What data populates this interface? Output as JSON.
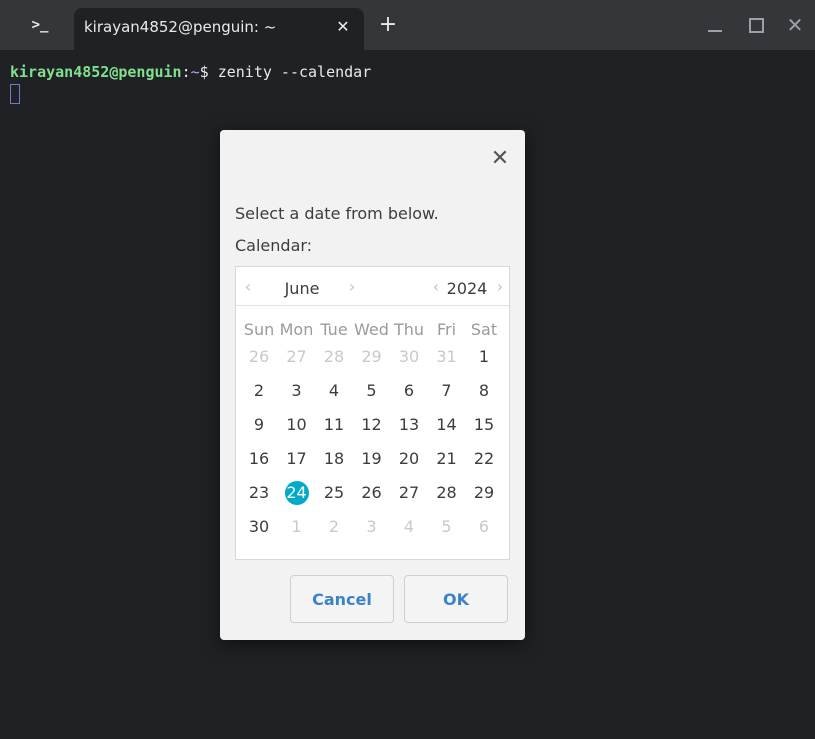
{
  "window": {
    "app_icon": ">_",
    "tab_title": "kirayan4852@penguin: ~",
    "tab_close": "✕",
    "new_tab": "+",
    "close_glyph": "✕"
  },
  "terminal": {
    "prompt_user": "kirayan4852@penguin",
    "prompt_sep": ":",
    "prompt_path": "~",
    "prompt_symbol": "$ ",
    "command": "zenity --calendar"
  },
  "dialog": {
    "close_glyph": "✕",
    "text": "Select a date from below.",
    "label": "Calendar:",
    "calendar": {
      "prev": "‹",
      "next": "›",
      "month": "June",
      "year": "2024",
      "weekdays": [
        "Sun",
        "Mon",
        "Tue",
        "Wed",
        "Thu",
        "Fri",
        "Sat"
      ],
      "weeks": [
        [
          "26",
          "27",
          "28",
          "29",
          "30",
          "31",
          "1"
        ],
        [
          "2",
          "3",
          "4",
          "5",
          "6",
          "7",
          "8"
        ],
        [
          "9",
          "10",
          "11",
          "12",
          "13",
          "14",
          "15"
        ],
        [
          "16",
          "17",
          "18",
          "19",
          "20",
          "21",
          "22"
        ],
        [
          "23",
          "24",
          "25",
          "26",
          "27",
          "28",
          "29"
        ],
        [
          "30",
          "1",
          "2",
          "3",
          "4",
          "5",
          "6"
        ]
      ],
      "selected_day": "24",
      "accent_color": "#00aac8"
    },
    "cancel_label": "Cancel",
    "ok_label": "OK"
  }
}
